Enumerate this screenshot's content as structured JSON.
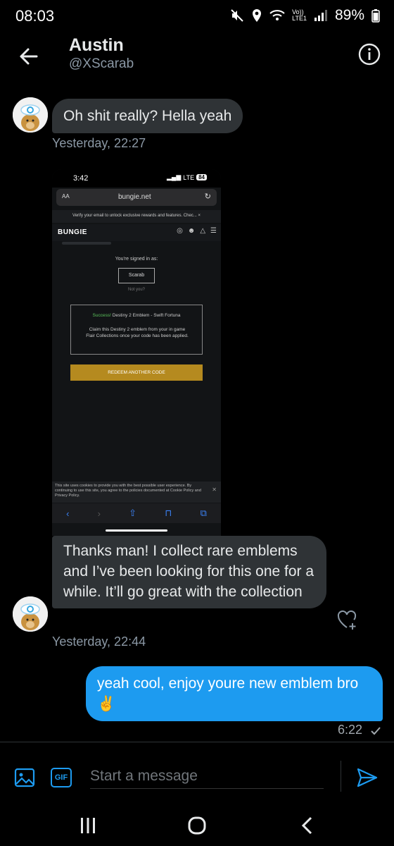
{
  "status_bar": {
    "time": "08:03",
    "network": "Vo))\nLTE1",
    "battery": "89%"
  },
  "header": {
    "name": "Austin",
    "handle": "@XScarab"
  },
  "messages": [
    {
      "direction": "in",
      "text": "Oh shit really? Hella yeah",
      "time": "Yesterday, 22:27"
    },
    {
      "direction": "in",
      "text": "Thanks man! I collect rare emblems and I’ve been looking for this one for a while. It’ll go great with the collection",
      "time": "Yesterday, 22:44"
    },
    {
      "direction": "out",
      "text": "yeah cool, enjoy youre new emblem bro",
      "emoji": "✌️",
      "time": "6:22",
      "status_icon": "check-icon"
    }
  ],
  "attachment": {
    "status_time": "3:42",
    "status_network": "LTE",
    "status_battery": "84",
    "url_aa": "AA",
    "url_host": "bungie.net",
    "banner": "Verify your email to unlock exclusive rewards and features. Chec... ×",
    "logo": "BUNGIE",
    "signed_in_as": "You're signed in as:",
    "username": "Scarab",
    "not_you": "Not you?",
    "success_label": "Success!",
    "success_item": "Destiny 2 Emblem - Swift Fortuna",
    "success_body": "Claim this Destiny 2 emblem from your in game Flair Collections once your code has been applied.",
    "redeem_button": "REDEEM ANOTHER CODE",
    "cookie_text": "This site uses cookies to provide you with the best possible user experience. By continuing to use this site, you agree to the policies documented at Cookie Policy and Privacy Policy.",
    "colors": {
      "success": "#5bc25b",
      "redeem": "#b58a1f",
      "toolbar": "#3b82f6"
    }
  },
  "composer": {
    "placeholder": "Start a message",
    "gif_label": "GIF"
  },
  "colors": {
    "accent": "#1d9bf0",
    "bubble_in": "#2f3336",
    "muted": "#8b98a5"
  }
}
